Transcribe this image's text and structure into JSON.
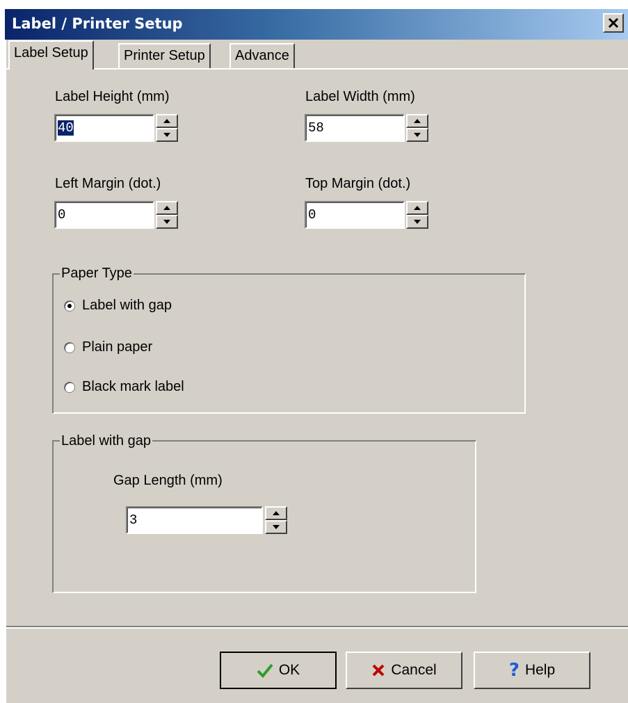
{
  "window": {
    "title": "Label / Printer Setup"
  },
  "tabs": [
    "Label Setup",
    "Printer Setup",
    "Advance"
  ],
  "fields": {
    "label_height": {
      "label": "Label Height (mm)",
      "value": "40"
    },
    "label_width": {
      "label": "Label Width (mm)",
      "value": "58"
    },
    "left_margin": {
      "label": "Left Margin (dot.)",
      "value": "0"
    },
    "top_margin": {
      "label": "Top Margin (dot.)",
      "value": "0"
    }
  },
  "paper_type": {
    "legend": "Paper Type",
    "options": [
      "Label with gap",
      "Plain paper",
      "Black mark label"
    ],
    "selected": "Label with gap"
  },
  "gap_group": {
    "legend": "Label with gap",
    "gap_label": "Gap Length (mm)",
    "gap_value": "3"
  },
  "buttons": {
    "ok": "OK",
    "cancel": "Cancel",
    "help": "Help"
  },
  "colors": {
    "title_start": "#0a246a",
    "title_end": "#a6caf0",
    "face": "#d4d0c8",
    "ok_icon": "#2e9c2e",
    "cancel_icon": "#c00000",
    "help_icon": "#1e5bd8"
  },
  "icons": {
    "close": "close-icon",
    "ok": "checkmark-icon",
    "cancel": "x-icon",
    "help": "question-icon"
  }
}
